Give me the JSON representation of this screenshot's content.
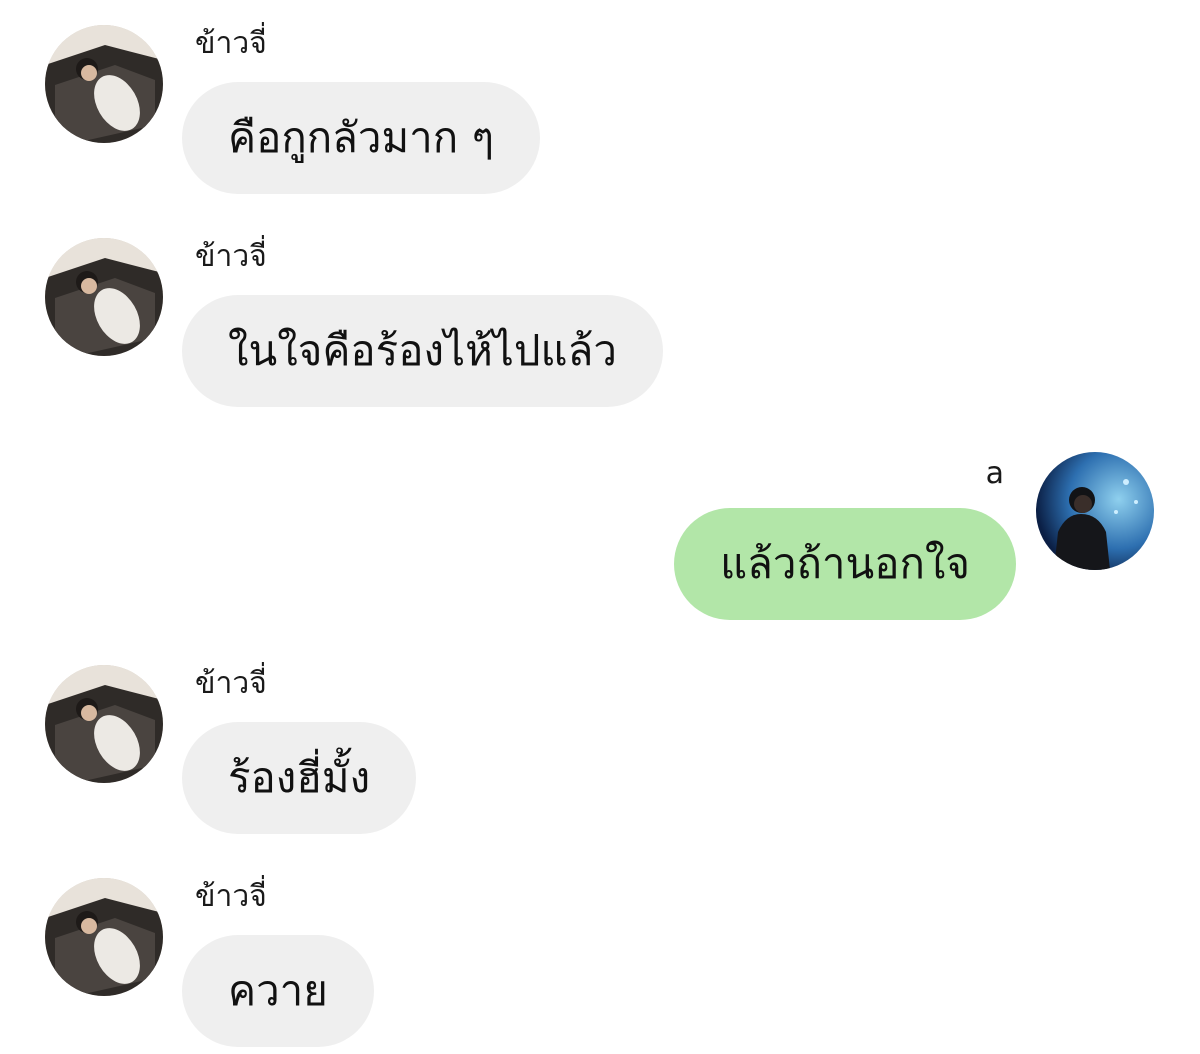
{
  "messages": [
    {
      "sender": "ข้าวจี่",
      "text": "คือกูกลัวมาก ๆ",
      "side": "incoming",
      "avatar": "avatar-khaojee-icon"
    },
    {
      "sender": "ข้าวจี่",
      "text": "ในใจคือร้องไห้ไปแล้ว",
      "side": "incoming",
      "avatar": "avatar-khaojee-icon"
    },
    {
      "sender": "a",
      "text": "แล้วถ้านอกใจ",
      "side": "outgoing",
      "avatar": "avatar-a-icon"
    },
    {
      "sender": "ข้าวจี่",
      "text": "ร้องฮี่มั้ง",
      "side": "incoming",
      "avatar": "avatar-khaojee-icon"
    },
    {
      "sender": "ข้าวจี่",
      "text": "ควาย",
      "side": "incoming",
      "avatar": "avatar-khaojee-icon"
    }
  ],
  "colors": {
    "incoming_bubble": "#efefef",
    "outgoing_bubble": "#b2e6a8",
    "background": "#ffffff"
  }
}
